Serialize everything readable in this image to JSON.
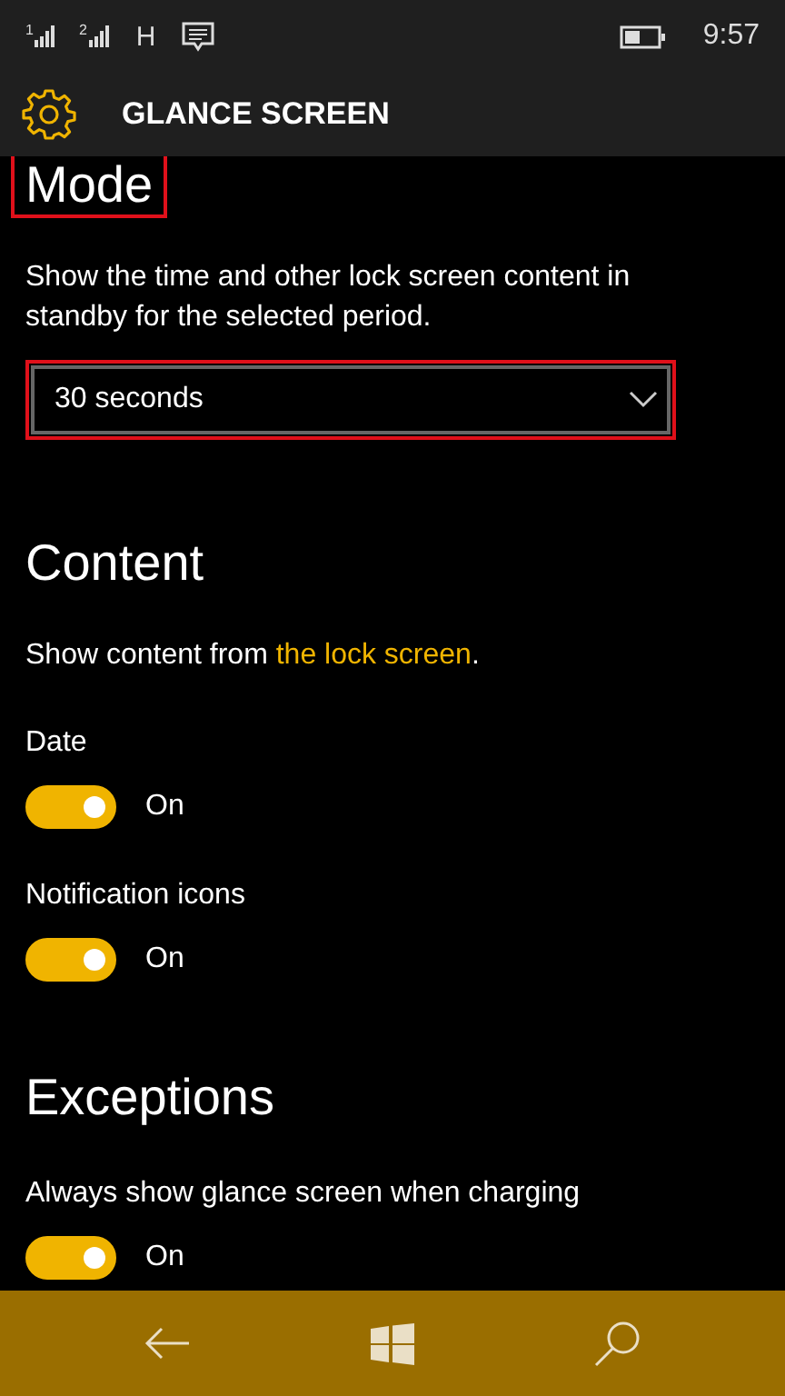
{
  "status_bar": {
    "sim_1": "1",
    "sim_2": "2",
    "network": "H",
    "time": "9:57"
  },
  "header": {
    "title": "GLANCE SCREEN"
  },
  "sections": [
    {
      "heading": "Mode",
      "highlighted": true,
      "items": [
        {
          "kind": "text",
          "text": "Show the time and other lock screen content in standby for the selected period."
        },
        {
          "kind": "dropdown",
          "value": "30 seconds",
          "highlighted": true
        }
      ]
    },
    {
      "heading": "Content",
      "highlighted": false,
      "items": [
        {
          "kind": "link-text",
          "text": "Show content from ",
          "link": "the lock screen",
          "after": "."
        },
        {
          "kind": "toggle",
          "label": "Date",
          "on": true,
          "state_text": "On"
        },
        {
          "kind": "toggle",
          "label": "Notification icons",
          "on": true,
          "state_text": "On"
        }
      ]
    },
    {
      "heading": "Exceptions",
      "highlighted": false,
      "items": [
        {
          "kind": "toggle",
          "label": "Always show glance screen when charging",
          "on": true,
          "state_text": "On"
        }
      ]
    }
  ]
}
